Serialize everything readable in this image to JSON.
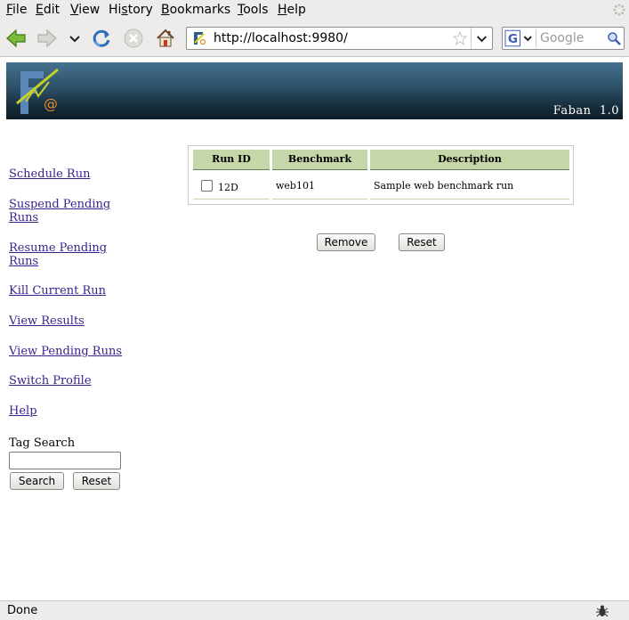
{
  "menubar": {
    "items": [
      {
        "label": "File",
        "u": "F",
        "rest": "ile"
      },
      {
        "label": "Edit",
        "u": "E",
        "rest": "dit"
      },
      {
        "label": "View",
        "u": "V",
        "rest": "iew"
      },
      {
        "label": "History",
        "u": "s",
        "pre": "Hi",
        "rest": "tory"
      },
      {
        "label": "Bookmarks",
        "u": "B",
        "rest": "ookmarks"
      },
      {
        "label": "Tools",
        "u": "T",
        "rest": "ools"
      },
      {
        "label": "Help",
        "u": "H",
        "rest": "elp"
      }
    ]
  },
  "toolbar": {
    "url": "http://localhost:9980/",
    "search_placeholder": "Google"
  },
  "banner": {
    "brand": "Faban  1.0"
  },
  "sidebar": {
    "links": [
      "Schedule Run",
      "Suspend Pending Runs",
      "Resume Pending Runs",
      "Kill Current Run",
      "View Results",
      "View Pending Runs",
      "Switch Profile",
      "Help"
    ],
    "tag_search_label": "Tag Search",
    "tag_search_value": "",
    "search_button": "Search",
    "reset_button": "Reset"
  },
  "runs": {
    "columns": [
      "Run ID",
      "Benchmark",
      "Description"
    ],
    "rows": [
      {
        "run_id": "12D",
        "benchmark": "web101",
        "description": "Sample web benchmark run",
        "checked": false
      }
    ],
    "remove_button": "Remove",
    "reset_button": "Reset"
  },
  "status": {
    "text": "Done"
  },
  "colors": {
    "link": "#3a1f8c",
    "table_header": "#c5d6a8",
    "banner_top": "#46728f",
    "banner_bottom": "#0d1c26"
  }
}
